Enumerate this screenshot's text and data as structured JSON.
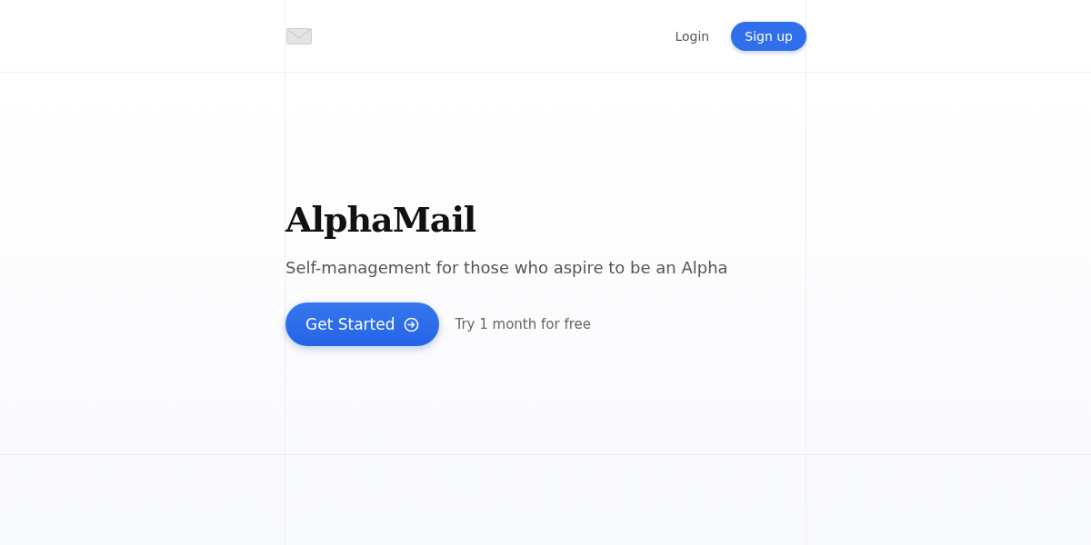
{
  "header": {
    "login": "Login",
    "signup": "Sign up"
  },
  "hero": {
    "title": "AlphaMail",
    "subtitle": "Self-management for those who aspire to be an Alpha",
    "cta": "Get Started",
    "note": "Try 1 month for free"
  }
}
